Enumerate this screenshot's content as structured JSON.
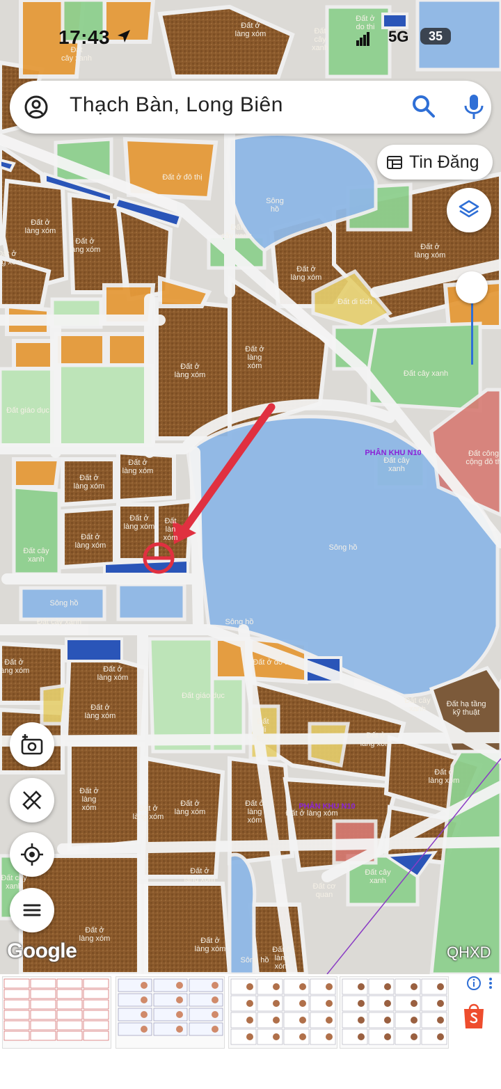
{
  "status_bar": {
    "time": "17:43",
    "network": "5G",
    "battery": "35"
  },
  "search": {
    "value": "Thạch Bàn, Long Biên"
  },
  "tin_dang": {
    "label": "Tin Đăng"
  },
  "map": {
    "labels": {
      "l1": "Đất ở\ndo thi",
      "l2": "Đất ở\nlàng xóm",
      "l3": "Đất\ncây\nxanh",
      "l4": "Đất\ncây xanh",
      "l5": "Đất ở đô thị",
      "l6": "Sông\nhồ",
      "l7": "Đất\ncây xanh",
      "l8": "Đất ở\nlàng xóm",
      "l9": "Đất ở\nlàng xóm",
      "l10": "Đất ở\nlàng xóm",
      "l11": "Đất ở\nlàng xóm",
      "l12": "Đất di tích",
      "l13": "Đất ở\nlàng xóm",
      "l14": "Đất ở\nlàng xóm",
      "l15": "Đất cây xanh",
      "l16": "Đất giáo dục",
      "l17": "Đất ở\nlàng\nxóm",
      "l18": "Đất ở\nlàng xóm",
      "l19": "Đất ở\nlàng xóm",
      "l20": "Đất ở\nlàng xóm",
      "l21": "Đất ở\nlàng xóm",
      "l22": "Đất\nlàn\nxóm",
      "l23": "Đất cây\nxanh",
      "l24": "Sông hồ",
      "l25": "Đất cây xanh",
      "l26": "Sông hồ",
      "l27": "Sông hồ",
      "l28": "Đất cây\nxanh",
      "l29": "Đất công\ncộng đô th",
      "l30": "Đất ở\nlàng xóm",
      "l31": "Đất ở đô thị",
      "l32": "Đất ở\nlàng xóm",
      "l33": "Đất giáo dục",
      "l34": "Đất\ndi\ntích",
      "l35": "Đất ở\nlàng xóm",
      "l36": "Đất cây\nxanh",
      "l37": "Đất hạ tầng\nkỹ thuật",
      "l38": "Đất ở\nlàng xóm",
      "l39": "Đất ở\nlàng\nxóm",
      "l40": "Đất ở\nlàng xóm",
      "l41": "Đất ở\nlàng xóm",
      "l42": "Đất ở làng xóm",
      "l43": "Đất ở\nlàng\nxóm",
      "l44": "Đất cây\nxanh",
      "l45": "Đất cơ\nquan",
      "l46": "Đất ở\nlàng xóm",
      "l47": "Đất ở\nlàng xóm",
      "l48": "Sông hồ",
      "l49": "Đất ở\nlàng xóm",
      "l50": "Đất cây\nxanh",
      "l51": "Đất ở\nlàng xóm",
      "l52": "Đất ở\nlàng\nxóm"
    },
    "zone_labels": {
      "z1": "PHÂN KHU N10",
      "z2": "PHÂN KHU N10"
    },
    "attribution": "Google",
    "source": "QHXD"
  },
  "controls": {
    "layers_icon": "layers-icon",
    "camera_icon": "camera-plus-icon",
    "ruler_icon": "measure-icon",
    "locate_icon": "my-location-icon",
    "menu_icon": "menu-icon"
  },
  "colors": {
    "residential": "#8a5a2b",
    "urban_residential": "#e59a3a",
    "green": "#8fd08f",
    "water": "#8fb8e6",
    "education": "#bde4b8",
    "heritage": "#e6cf6e",
    "public": "#d77b74",
    "parking_blue": "#2a55b8",
    "road": "#ececec",
    "marker": "#e03040"
  }
}
